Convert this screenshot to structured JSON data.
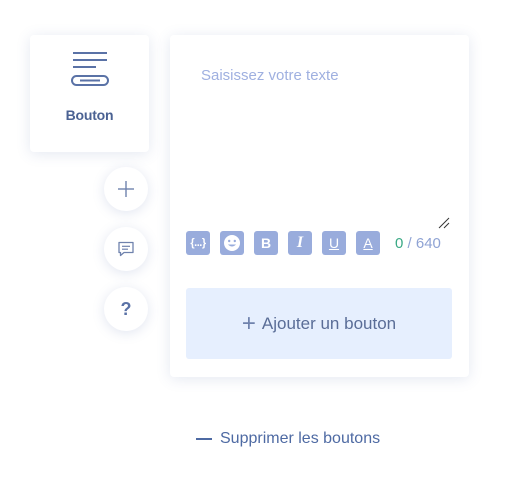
{
  "block": {
    "label": "Bouton",
    "icon": "button-block-icon"
  },
  "side_buttons": [
    {
      "icon": "plus-icon"
    },
    {
      "icon": "comment-icon"
    },
    {
      "icon": "help-icon",
      "glyph": "?"
    }
  ],
  "editor": {
    "placeholder": "Saisissez votre texte",
    "value": "",
    "toolbar": {
      "variable_label": "{...}",
      "emoji_icon": "smiley-icon",
      "bold_label": "B",
      "italic_label": "I",
      "underline_label": "U",
      "color_label": "A"
    },
    "counter": {
      "current": "0",
      "separator": " / ",
      "max": "640"
    },
    "add_button": {
      "plus": "+",
      "label": "Ajouter un bouton"
    }
  },
  "remove_link": {
    "label": "Supprimer les boutons"
  },
  "colors": {
    "accent": "#99acdc",
    "text": "#4b6293",
    "counter_current": "#3aa985",
    "add_button_bg": "#e6effe"
  }
}
